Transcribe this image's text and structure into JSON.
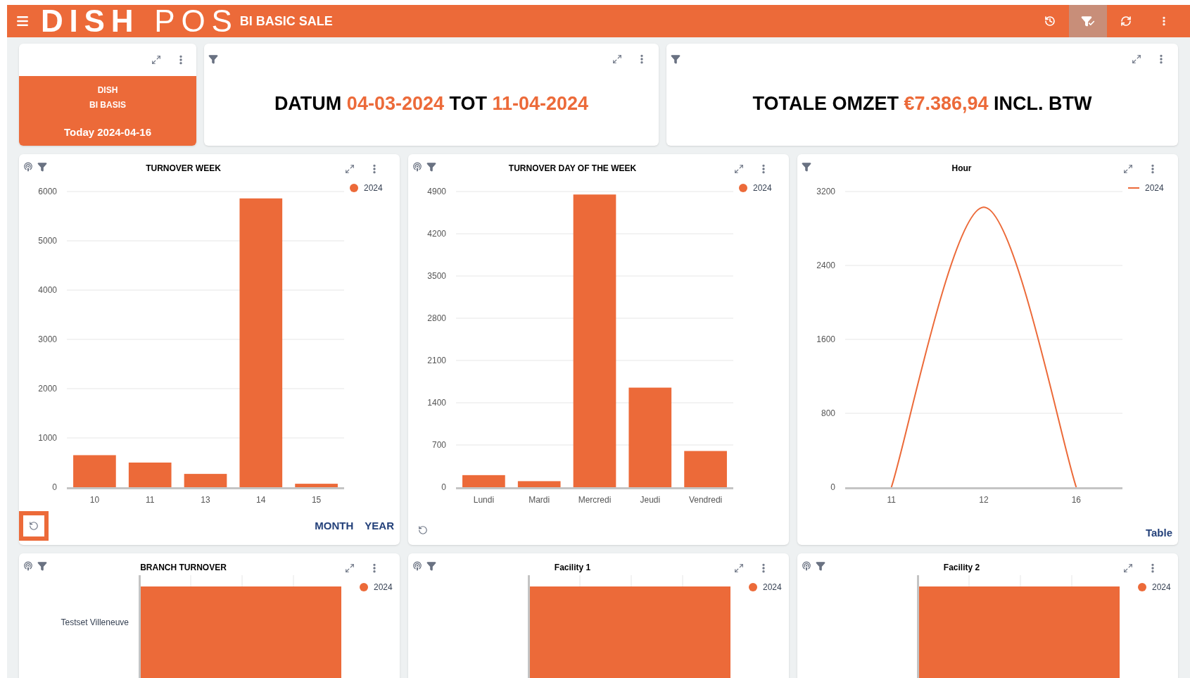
{
  "header": {
    "logo": "**DISH** POS",
    "title": "BI BASIC SALE",
    "tools": [
      {
        "kind": "history",
        "selected": false
      },
      {
        "kind": "filter",
        "selected": true
      },
      {
        "kind": "refresh",
        "selected": false
      },
      {
        "kind": "more",
        "selected": false
      }
    ]
  },
  "brand_card": {
    "lines": [
      "DISH",
      "BI BASIS"
    ],
    "date": "Today 2024-04-16"
  },
  "stat_cards": [
    {
      "parts": [
        {
          "text": "DATUM",
          "accent": false
        },
        {
          "text": "04-03-2024",
          "accent": true
        },
        {
          "text": "TOT",
          "accent": false
        },
        {
          "text": "11-04-2024",
          "accent": true
        }
      ]
    },
    {
      "parts": [
        {
          "text": "TOTALE OMZET",
          "accent": false
        },
        {
          "text": "€7.386,94",
          "accent": true
        },
        {
          "text": "INCL. BTW",
          "accent": false
        }
      ]
    }
  ],
  "charts": [
    {
      "title": "TURNOVER WEEK",
      "linked": true,
      "reset_button": {
        "highlighted": true
      },
      "links": [
        "MONTH",
        "YEAR"
      ],
      "chart_data": {
        "type": "bar",
        "categories": [
          "10",
          "11",
          "13",
          "14",
          "15"
        ],
        "series": [
          {
            "name": "2024",
            "color": "#ec6a39",
            "values": [
              650,
              500,
              270,
              5860,
              70
            ]
          }
        ],
        "grid": true,
        "ylim": [
          0,
          6000
        ],
        "yticks": [
          0,
          1000,
          2000,
          3000,
          4000,
          5000,
          6000
        ]
      }
    },
    {
      "title": "TURNOVER DAY OF THE WEEK",
      "linked": true,
      "reset_button": {
        "highlighted": false
      },
      "chart_data": {
        "type": "bar",
        "categories": [
          "Lundi",
          "Mardi",
          "Mercredi",
          "Jeudi",
          "Vendredi"
        ],
        "series": [
          {
            "name": "2024",
            "color": "#ec6a39",
            "values": [
              200,
              100,
              4850,
              1650,
              600
            ]
          }
        ],
        "grid": true,
        "ylim": [
          0,
          4900
        ],
        "yticks": [
          0,
          700,
          1400,
          2100,
          2800,
          3500,
          4200,
          4900
        ]
      }
    },
    {
      "title": "Hour",
      "linked": false,
      "links": [
        "Table"
      ],
      "chart_data": {
        "type": "line",
        "categories": [
          "11",
          "12",
          "16"
        ],
        "series": [
          {
            "name": "2024",
            "color": "#ec6a39",
            "values": [
              0,
              3030,
              0
            ]
          }
        ],
        "grid": true,
        "ylim": [
          0,
          3200
        ],
        "yticks": [
          0,
          800,
          1600,
          2400,
          3200
        ]
      }
    }
  ],
  "bottom_panels": [
    {
      "title": "BRANCH TURNOVER",
      "linked": true,
      "legend": "2024",
      "category_label": "Testset Villeneuve"
    },
    {
      "title": "Facility 1",
      "linked": true,
      "legend": "2024"
    },
    {
      "title": "Facility 2",
      "linked": true,
      "legend": "2024"
    }
  ]
}
